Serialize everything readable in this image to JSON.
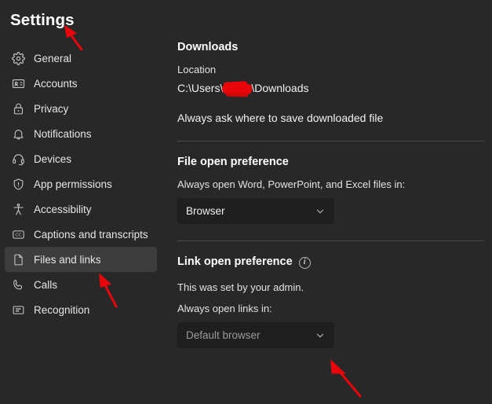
{
  "window": {
    "title": "Settings",
    "background": "#282828",
    "accent_annotation_color": "#e8060b"
  },
  "sidebar": {
    "title": "Settings",
    "items": [
      {
        "label": "General",
        "icon": "gear-icon",
        "selected": false
      },
      {
        "label": "Accounts",
        "icon": "contact-card-icon",
        "selected": false
      },
      {
        "label": "Privacy",
        "icon": "lock-icon",
        "selected": false
      },
      {
        "label": "Notifications",
        "icon": "bell-icon",
        "selected": false
      },
      {
        "label": "Devices",
        "icon": "headset-icon",
        "selected": false
      },
      {
        "label": "App permissions",
        "icon": "shield-icon",
        "selected": false
      },
      {
        "label": "Accessibility",
        "icon": "accessibility-person-icon",
        "selected": false
      },
      {
        "label": "Captions and transcripts",
        "icon": "closed-caption-icon",
        "selected": false
      },
      {
        "label": "Files and links",
        "icon": "file-document-icon",
        "selected": true
      },
      {
        "label": "Calls",
        "icon": "phone-icon",
        "selected": false
      },
      {
        "label": "Recognition",
        "icon": "award-badge-icon",
        "selected": false
      }
    ]
  },
  "main": {
    "downloads": {
      "heading": "Downloads",
      "location_label": "Location",
      "path_prefix": "C:\\Users\\",
      "path_redacted": "",
      "path_suffix": "\\Downloads",
      "always_ask_label": "Always ask where to save downloaded file"
    },
    "file_open_preference": {
      "heading": "File open preference",
      "description": "Always open Word, PowerPoint, and Excel files in:",
      "dropdown_value": "Browser",
      "dropdown_icon": "chevron-down-icon"
    },
    "link_open_preference": {
      "heading": "Link open preference",
      "info_icon": "info-icon",
      "info_glyph": "i",
      "admin_note": "This was set by your admin.",
      "description": "Always open links in:",
      "dropdown_value": "Default browser",
      "dropdown_icon": "chevron-down-icon",
      "dropdown_disabled": true
    }
  },
  "annotations": [
    {
      "name": "arrow-to-settings-title",
      "color": "#e8060b"
    },
    {
      "name": "arrow-to-files-and-links",
      "color": "#e8060b"
    },
    {
      "name": "arrow-to-link-dropdown",
      "color": "#e8060b"
    }
  ]
}
